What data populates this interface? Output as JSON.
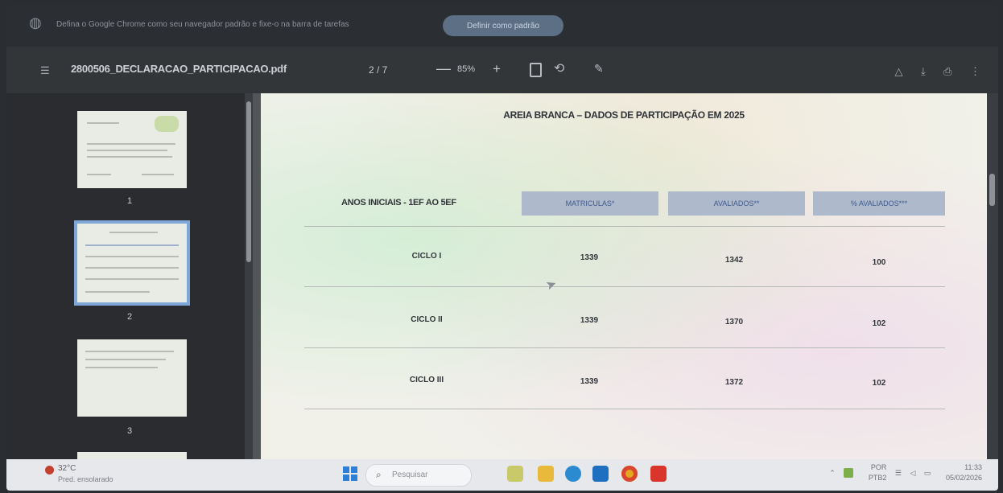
{
  "browser": {
    "infobar_message": "Defina o Google Chrome como seu navegador padrão e fixe-o na barra de tarefas",
    "infobar_button": "Definir como padrão"
  },
  "pdf_toolbar": {
    "filename": "2800506_DECLARACAO_PARTICIPACAO.pdf",
    "page_indicator": "2 / 7",
    "zoom": "85%",
    "minus": "—",
    "plus": "+"
  },
  "thumbnails": [
    {
      "label": "1",
      "selected": false
    },
    {
      "label": "2",
      "selected": true
    },
    {
      "label": "3",
      "selected": false
    }
  ],
  "document": {
    "title": "AREIA BRANCA – DADOS DE PARTICIPAÇÃO EM 2025",
    "row_header": "ANOS INICIAIS - 1EF AO 5EF",
    "columns": [
      "MATRICULAS*",
      "AVALIADOS**",
      "% AVALIADOS***"
    ],
    "rows": [
      {
        "label": "CICLO I",
        "matriculas": "1339",
        "avaliados": "1342",
        "percent": "100"
      },
      {
        "label": "CICLO II",
        "matriculas": "1339",
        "avaliados": "1370",
        "percent": "102"
      },
      {
        "label": "CICLO III",
        "matriculas": "1339",
        "avaliados": "1372",
        "percent": "102"
      }
    ]
  },
  "taskbar": {
    "weather_temp": "32°C",
    "weather_desc": "Pred. ensolarado",
    "search_placeholder": "Pesquisar",
    "lang_top": "POR",
    "lang_bottom": "PTB2",
    "time": "11:33",
    "date": "05/02/2026"
  },
  "colors": {
    "accent": "#7ea7d8",
    "header_cell": "#aeb9cc",
    "pdf_icon": "#d9352a",
    "chrome_btn": "#5d6f85"
  }
}
